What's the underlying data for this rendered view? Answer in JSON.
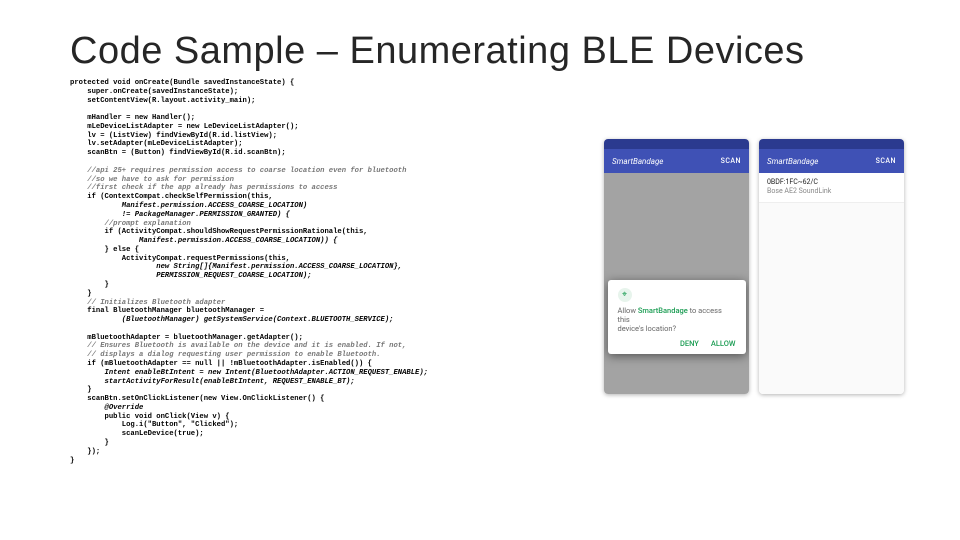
{
  "title": "Code Sample – Enumerating BLE Devices",
  "code": {
    "l01": "protected void onCreate(Bundle savedInstanceState) {",
    "l02": "    super.onCreate(savedInstanceState);",
    "l03": "    setContentView(R.layout.activity_main);",
    "l04": "    mHandler = new Handler();",
    "l05": "    mLeDeviceListAdapter = new LeDeviceListAdapter();",
    "l06": "    lv = (ListView) findViewById(R.id.listView);",
    "l07": "    lv.setAdapter(mLeDeviceListAdapter);",
    "l08": "    scanBtn = (Button) findViewById(R.id.scanBtn);",
    "l09": "    //api 25+ requires permission access to coarse location even for bluetooth",
    "l10": "    //so we have to ask for permission",
    "l11": "    //first check if the app already has permissions to access",
    "l12": "    if (ContextCompat.checkSelfPermission(this,",
    "l13": "            Manifest.permission.ACCESS_COARSE_LOCATION)",
    "l14": "            != PackageManager.PERMISSION_GRANTED) {",
    "l15": "        //prompt explanation",
    "l16": "        if (ActivityCompat.shouldShowRequestPermissionRationale(this,",
    "l17": "                Manifest.permission.ACCESS_COARSE_LOCATION)) {",
    "l18": "        } else {",
    "l19": "            ActivityCompat.requestPermissions(this,",
    "l20": "                    new String[]{Manifest.permission.ACCESS_COARSE_LOCATION},",
    "l21": "                    PERMISSION_REQUEST_COARSE_LOCATION);",
    "l22": "        }",
    "l23": "    }",
    "l24": "    // Initializes Bluetooth adapter",
    "l25": "    final BluetoothManager bluetoothManager =",
    "l26": "            (BluetoothManager) getSystemService(Context.BLUETOOTH_SERVICE);",
    "l27": "    mBluetoothAdapter = bluetoothManager.getAdapter();",
    "l28": "    // Ensures Bluetooth is available on the device and it is enabled. If not,",
    "l29": "    // displays a dialog requesting user permission to enable Bluetooth.",
    "l30": "    if (mBluetoothAdapter == null || !mBluetoothAdapter.isEnabled()) {",
    "l31": "        Intent enableBtIntent = new Intent(BluetoothAdapter.ACTION_REQUEST_ENABLE);",
    "l32": "        startActivityForResult(enableBtIntent, REQUEST_ENABLE_BT);",
    "l33": "    }",
    "l34": "    scanBtn.setOnClickListener(new View.OnClickListener() {",
    "l35": "        @Override",
    "l36": "        public void onClick(View v) {",
    "l37": "            Log.i(\"Button\", \"Clicked\");",
    "l38": "            scanLeDevice(true);",
    "l39": "        }",
    "l40": "    });",
    "l41": "}"
  },
  "phone1": {
    "app_title": "SmartBandage",
    "scan": "SCAN",
    "dialog_app": "SmartBandage",
    "dialog_msg1": "Allow ",
    "dialog_msg2": " to access this",
    "dialog_msg3": "device's location?",
    "deny": "DENY",
    "allow": "ALLOW"
  },
  "phone2": {
    "app_title": "SmartBandage",
    "scan": "SCAN",
    "item_title": "0BDF:1FC~62/C",
    "item_sub": "Bose AE2 SoundLink"
  }
}
